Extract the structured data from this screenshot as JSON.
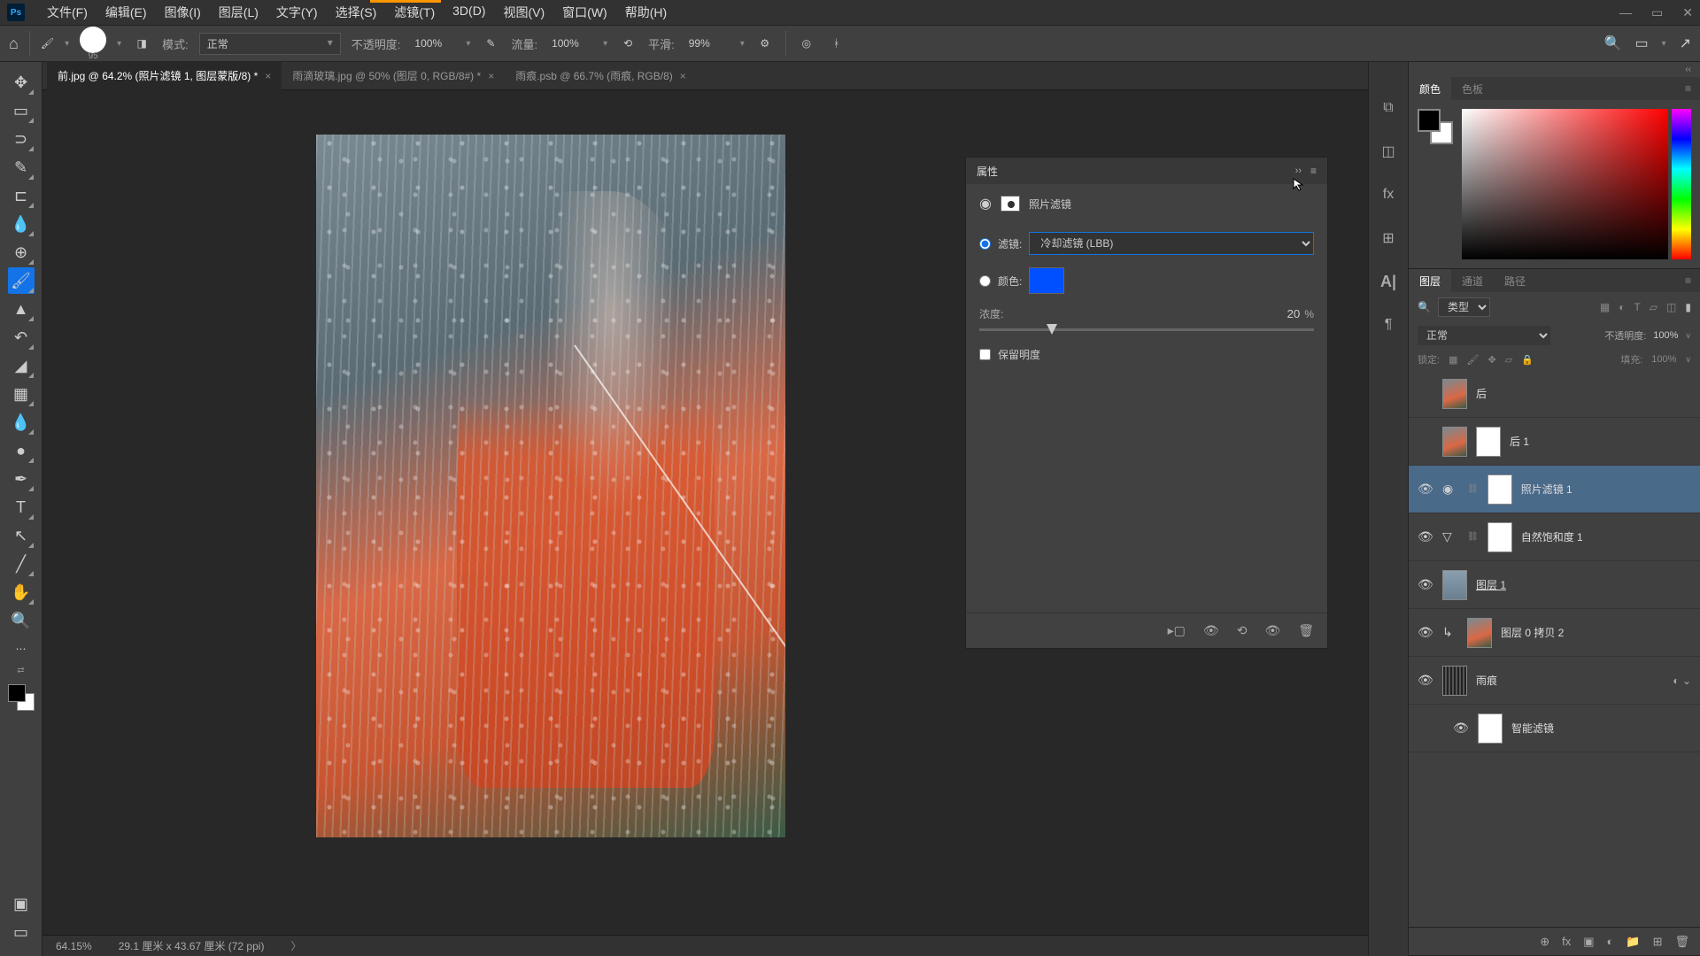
{
  "menu": [
    "文件(F)",
    "编辑(E)",
    "图像(I)",
    "图层(L)",
    "文字(Y)",
    "选择(S)",
    "滤镜(T)",
    "3D(D)",
    "视图(V)",
    "窗口(W)",
    "帮助(H)"
  ],
  "options": {
    "brush_size": "95",
    "mode_label": "模式:",
    "mode_value": "正常",
    "opacity_label": "不透明度:",
    "opacity_value": "100%",
    "flow_label": "流量:",
    "flow_value": "100%",
    "smooth_label": "平滑:",
    "smooth_value": "99%"
  },
  "tabs": [
    {
      "label": "前.jpg @ 64.2% (照片滤镜 1, 图层蒙版/8) *",
      "active": true
    },
    {
      "label": "雨滴玻璃.jpg @ 50% (图层 0, RGB/8#) *",
      "active": false
    },
    {
      "label": "雨痕.psb @ 66.7% (雨痕, RGB/8)",
      "active": false
    }
  ],
  "status": {
    "zoom": "64.15%",
    "dims": "29.1 厘米 x 43.67 厘米 (72 ppi)"
  },
  "properties": {
    "title": "属性",
    "adj_name": "照片滤镜",
    "filter_label": "滤镜:",
    "filter_value": "冷却滤镜 (LBB)",
    "color_label": "颜色:",
    "density_label": "浓度:",
    "density_value": "20",
    "density_pct": "%",
    "preserve_label": "保留明度"
  },
  "color_tabs": [
    "颜色",
    "色板"
  ],
  "layer_tabs": [
    "图层",
    "通道",
    "路径"
  ],
  "layer_opts": {
    "kind_label": "类型",
    "blend_mode": "正常",
    "opacity_label": "不透明度:",
    "opacity_value": "100%",
    "lock_label": "锁定:",
    "fill_label": "填充:",
    "fill_value": "100%"
  },
  "layers": [
    {
      "name": "后",
      "visible": false,
      "adj": false,
      "mask": false,
      "thumb": "photo"
    },
    {
      "name": "后 1",
      "visible": false,
      "adj": false,
      "mask": true,
      "thumb": "photo"
    },
    {
      "name": "照片滤镜 1",
      "visible": true,
      "adj": true,
      "mask": true,
      "selected": true,
      "adj_icon": "◉"
    },
    {
      "name": "自然饱和度 1",
      "visible": true,
      "adj": true,
      "mask": true,
      "adj_icon": "▽"
    },
    {
      "name": "图层 1",
      "visible": true,
      "adj": false,
      "mask": false,
      "thumb": "rain",
      "underline": true
    },
    {
      "name": "图层 0 拷贝 2",
      "visible": true,
      "adj": false,
      "mask": false,
      "thumb": "photo",
      "clip": true
    },
    {
      "name": "雨痕",
      "visible": true,
      "adj": false,
      "mask": false,
      "thumb": "rain2",
      "smart": true
    },
    {
      "name": "智能滤镜",
      "visible": true,
      "sub": true,
      "mask": true
    }
  ]
}
